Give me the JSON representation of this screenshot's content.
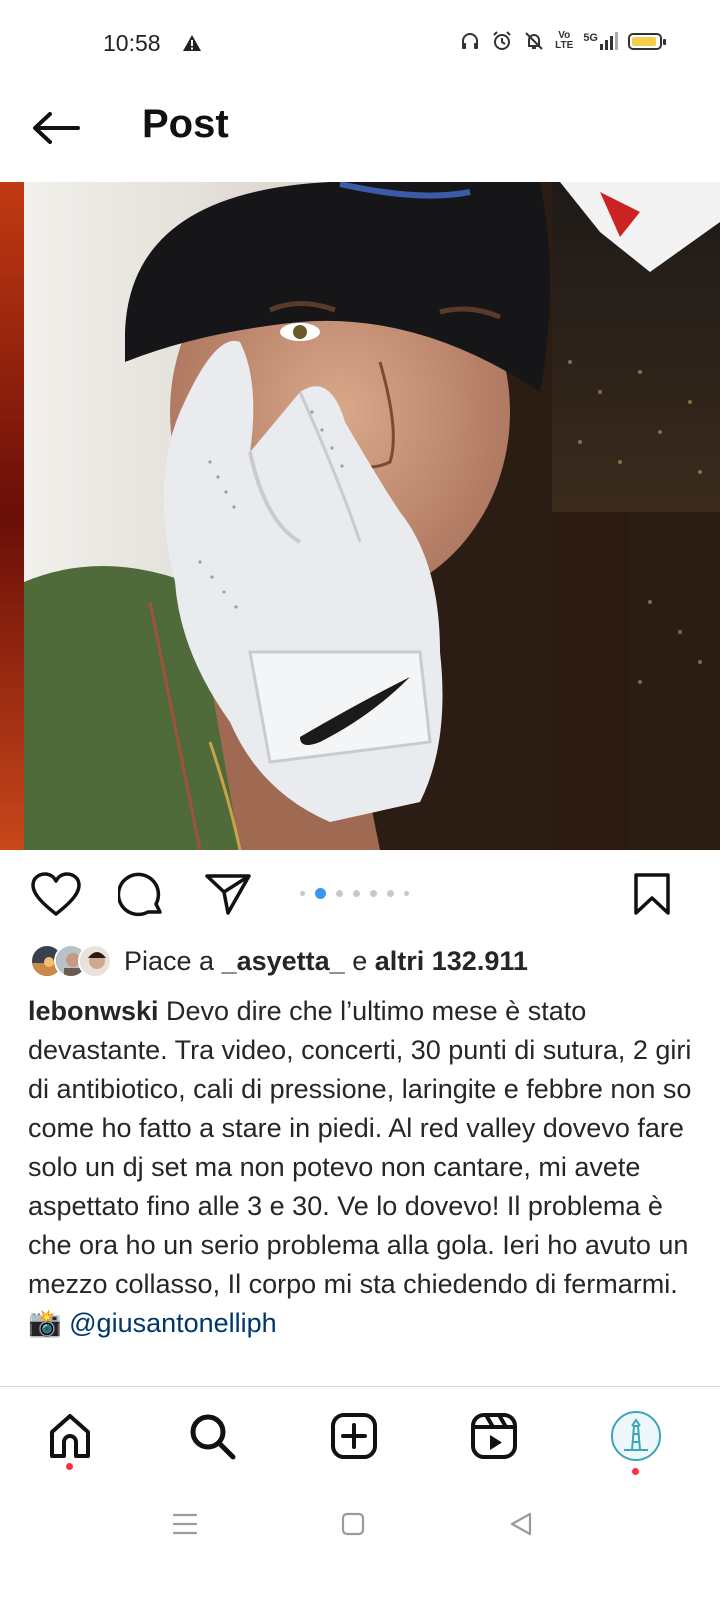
{
  "status_bar": {
    "time": "10:58",
    "network_label": "5G",
    "lte_label_top": "Vo",
    "lte_label_bottom": "LTE",
    "battery_color": "#f2d04e"
  },
  "header": {
    "title": "Post"
  },
  "post": {
    "carousel": {
      "total": 6,
      "active_index": 1
    },
    "likes": {
      "prefix": "Piace a",
      "user": "_asyetta_",
      "middle": "e",
      "count_text": "altri 132.911"
    },
    "caption": {
      "username": "lebonwski",
      "text": "Devo dire che l’ultimo mese è stato devastante. Tra video, concerti, 30 punti di sutura, 2 giri di antibiotico, cali di pressione, laringite e febbre non so come ho fatto a stare in piedi. Al red valley dovevo fare solo un dj set ma non potevo non cantare, mi avete aspettato fino alle 3 e 30. Ve lo dovevo! Il problema è che ora ho un serio problema alla gola. Ieri ho avuto un mezzo collasso, Il corpo mi sta chiedendo di fermarmi.",
      "camera_emoji": "📸",
      "mention": "@giusantonelliph"
    }
  },
  "bottom_nav": {
    "items": [
      "home-icon",
      "search-icon",
      "create-icon",
      "reels-icon",
      "profile-avatar"
    ]
  },
  "colors": {
    "accent": "#3897f0",
    "mention": "#00376b",
    "notification": "#ff3040"
  }
}
